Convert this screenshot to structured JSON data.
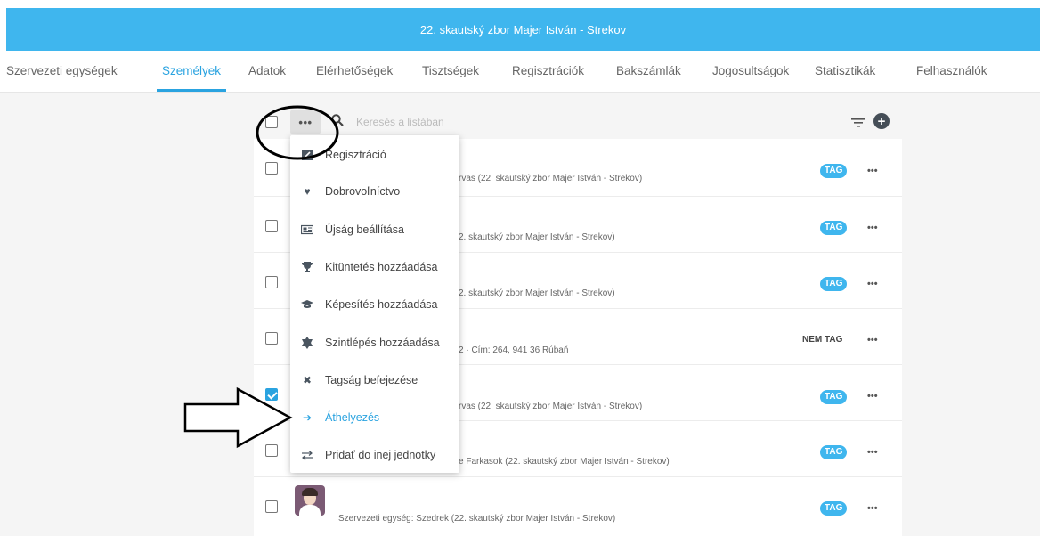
{
  "header": {
    "title": "22. skautský zbor Majer István - Strekov"
  },
  "nav": {
    "tabs": [
      {
        "label": "Szervezeti egységek"
      },
      {
        "label": "Személyek",
        "active": true
      },
      {
        "label": "Adatok"
      },
      {
        "label": "Elérhetőségek"
      },
      {
        "label": "Tisztségek"
      },
      {
        "label": "Regisztrációk"
      },
      {
        "label": "Bakszámlák"
      },
      {
        "label": "Jogosultságok"
      },
      {
        "label": "Statisztikák"
      },
      {
        "label": "Felhasználók"
      }
    ]
  },
  "toolbar": {
    "more_label": "•••",
    "search_placeholder": "Keresés a listában",
    "filter_icon": "filter-icon",
    "add_icon": "plus-circle-icon"
  },
  "dropdown": {
    "items": [
      {
        "label": "Regisztráció",
        "icon": "edit-icon"
      },
      {
        "label": "Dobrovoľníctvo",
        "icon": "heart-icon"
      },
      {
        "label": "Újság beállítása",
        "icon": "newspaper-icon"
      },
      {
        "label": "Kitüntetés hozzáadása",
        "icon": "trophy-icon"
      },
      {
        "label": "Képesítés hozzáadása",
        "icon": "graduation-cap-icon"
      },
      {
        "label": "Szintlépés hozzáadása",
        "icon": "badge-icon"
      },
      {
        "label": "Tagság befejezése",
        "icon": "close-icon"
      },
      {
        "label": "Áthelyezés",
        "icon": "arrow-right-icon",
        "highlight": true
      },
      {
        "label": "Pridať do inej jednotky",
        "icon": "exchange-icon"
      }
    ]
  },
  "rows": [
    {
      "sub": "rvas (22. skautský zbor Majer István - Strekov)",
      "badge": "TAG",
      "checked": false
    },
    {
      "sub": "2. skautský zbor Majer István - Strekov)",
      "badge": "TAG",
      "checked": false
    },
    {
      "sub": "2. skautský zbor Majer István - Strekov)",
      "badge": "TAG",
      "checked": false
    },
    {
      "sub": "2 · Cím: 264, 941 36 Rúbaň",
      "badge": "NEM TAG",
      "checked": false
    },
    {
      "sub": "rvas (22. skautský zbor Majer István - Strekov)",
      "badge": "TAG",
      "checked": true
    },
    {
      "sub": "e Farkasok (22. skautský zbor Majer István - Strekov)",
      "badge": "TAG",
      "checked": false
    },
    {
      "sub": "Szervezeti egység: Szedrek (22. skautský zbor Majer István - Strekov)",
      "badge": "TAG",
      "checked": false
    }
  ],
  "row_more_label": "•••",
  "colors": {
    "accent": "#3fb6ee",
    "link": "#2aa3e0"
  }
}
